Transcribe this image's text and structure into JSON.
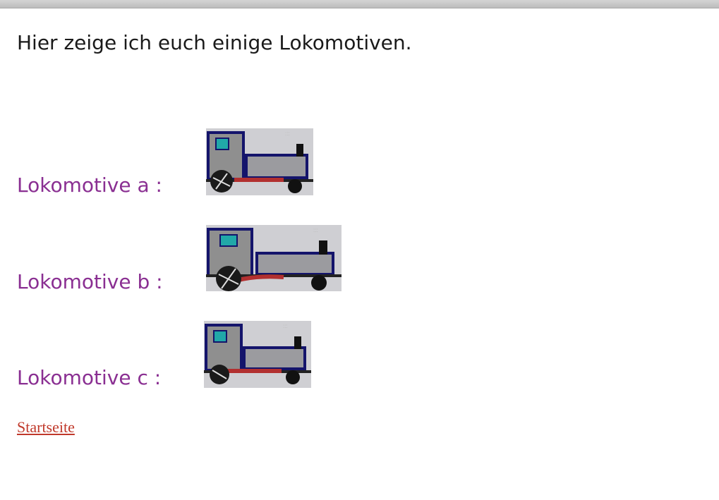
{
  "page": {
    "intro": "Hier zeige ich euch einige Lokomotiven.",
    "locomotives": [
      {
        "label": "Lokomotive a :",
        "image": "locomotive-image"
      },
      {
        "label": "Lokomotive b :",
        "image": "locomotive-image"
      },
      {
        "label": "Lokomotive c :",
        "image": "locomotive-image"
      }
    ],
    "home_link": "Startseite"
  },
  "colors": {
    "label": "#8a2f92",
    "link": "#c0392b",
    "intro": "#1a1a1a"
  }
}
